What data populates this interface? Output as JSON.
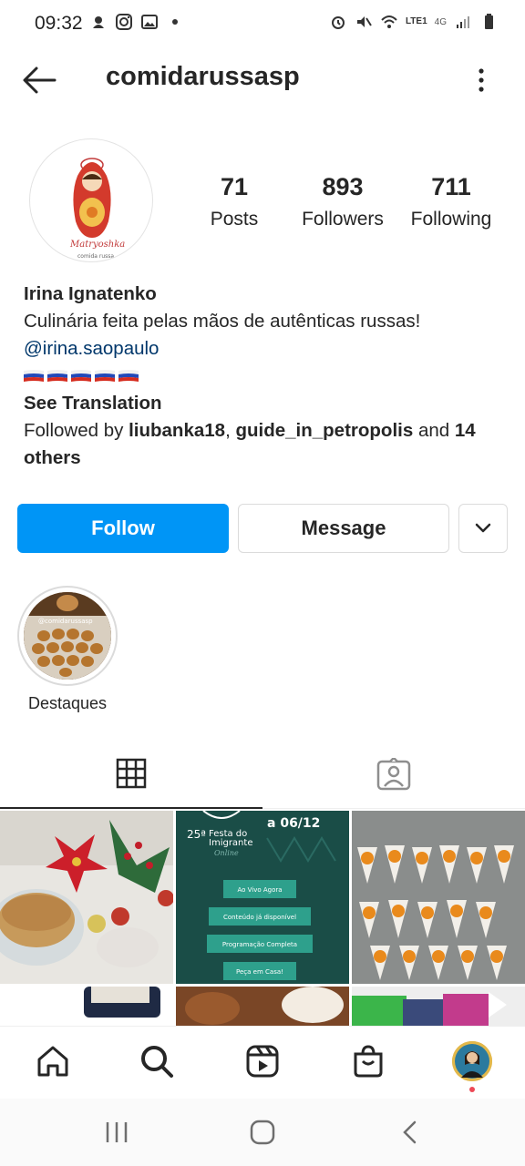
{
  "status_bar": {
    "time": "09:32",
    "network": "4G",
    "lte": "LTE1"
  },
  "header": {
    "username": "comidarussasp"
  },
  "avatar": {
    "brand": "Matryoshka",
    "subtitle": "comida russa"
  },
  "stats": [
    {
      "value": "71",
      "label": "Posts"
    },
    {
      "value": "893",
      "label": "Followers"
    },
    {
      "value": "711",
      "label": "Following"
    }
  ],
  "bio": {
    "name": "Irina Ignatenko",
    "description": "Culinária feita pelas mãos de autênticas russas!",
    "mention": "@irina.saopaulo",
    "see_translation": "See Translation",
    "followed_prefix": "Followed by ",
    "followed_user1": "liubanka18",
    "followed_sep": ", ",
    "followed_user2": "guide_in_petropolis",
    "followed_and": " and ",
    "followed_others": "14 others"
  },
  "buttons": {
    "follow": "Follow",
    "message": "Message"
  },
  "highlight": {
    "label": "Destaques",
    "overlay_text": "@comidarussasp"
  },
  "posts": {
    "post2": {
      "date": "a 06/12",
      "festa_number": "25ª",
      "festa_line1": "Festa do",
      "festa_line2": "Imigrante",
      "festa_line3": "Online",
      "buttons": [
        "Ao Vivo Agora",
        "Conteúdo já disponível",
        "Programação Completa",
        "Peça em Casa!"
      ]
    }
  },
  "colors": {
    "accent": "#0095f6",
    "text": "#262626",
    "link": "#00376b",
    "notification": "#ed4956"
  }
}
